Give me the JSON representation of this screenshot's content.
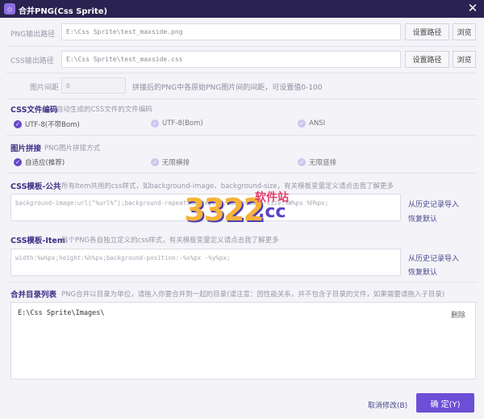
{
  "window": {
    "title": "合并PNG(Css Sprite)",
    "app_icon_glyph": "◇"
  },
  "png_output": {
    "label": "PNG输出路径",
    "value": "E:\\Css Sprite\\test_maxside.png",
    "set_path": "设置路径",
    "browse": "浏览"
  },
  "css_output": {
    "label": "CSS输出路径",
    "value": "E:\\Css Sprite\\test_maxside.css",
    "set_path": "设置路径",
    "browse": "浏览"
  },
  "spacing": {
    "label": "图片间距",
    "value": "0",
    "hint": "拼接后的PNG中各原始PNG图片间的间距，可设置值0-100"
  },
  "css_encoding": {
    "title": "CSS文件编码",
    "desc": "自动生成的CSS文件的文件编码",
    "options": [
      {
        "label": "UTF-8(不带Bom)",
        "selected": true
      },
      {
        "label": "UTF-8(Bom)",
        "selected": false
      },
      {
        "label": "ANSI",
        "selected": false
      }
    ]
  },
  "image_tiling": {
    "title": "图片拼接",
    "desc": "PNG图片拼接方式",
    "options": [
      {
        "label": "自适应(推荐)",
        "selected": true
      },
      {
        "label": "无限横排",
        "selected": false
      },
      {
        "label": "无限竖排",
        "selected": false
      }
    ]
  },
  "css_template_common": {
    "title": "CSS模板-公共",
    "desc": "所有Item共用的css样式，如background-image、background-size，有关模板变量定义请点击我了解更多",
    "value": "background-image:url(\"%url%\");background-repeat:no-repeat;background-size:%W%px %H%px;",
    "import_history": "从历史记录导入",
    "restore_default": "恢复默认"
  },
  "css_template_item": {
    "title": "CSS模板-Item",
    "desc": "每个PNG各自独立定义的css样式，有关模板变量定义请点击我了解更多",
    "value": "width:%w%px;height:%h%px;background-position:-%x%px -%y%px;",
    "import_history": "从历史记录导入",
    "restore_default": "恢复默认"
  },
  "merge_dirs": {
    "title": "合并目录列表",
    "desc": "PNG合并以目录为单位，请拖入你要合并到一起的目录(请注意：因性能关系，并不包含子目录的文件，如果需要请拖入子目录)",
    "items": [
      {
        "path": "E:\\Css Sprite\\Images\\",
        "delete": "删除"
      }
    ]
  },
  "footer": {
    "cancel": "取消修改(B)",
    "ok": "确 定(Y)"
  },
  "watermark": {
    "number": "3322",
    "brand": "软件站",
    "suffix": ".cc"
  },
  "colors": {
    "titlebar": "#2a2250",
    "accent": "#6c4fd6",
    "section_title": "#3b2f86"
  }
}
